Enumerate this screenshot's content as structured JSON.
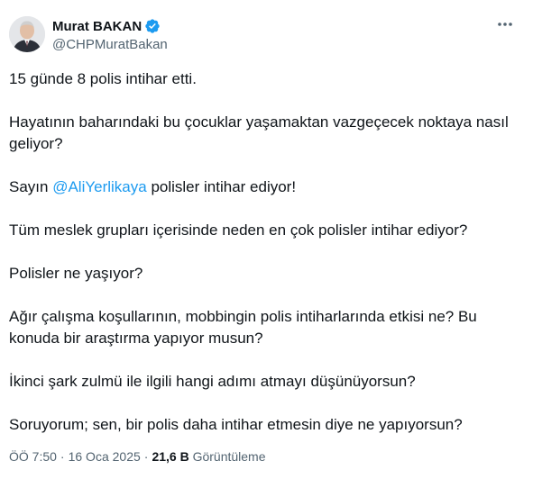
{
  "author": {
    "display_name": "Murat BAKAN",
    "handle": "@CHPMuratBakan"
  },
  "colors": {
    "verified": "#1d9bf0",
    "mention": "#1d9bf0",
    "text": "#0f1419",
    "muted": "#536471"
  },
  "icons": {
    "more": "more-dots-icon",
    "verified": "verified-badge-icon"
  },
  "tweet": {
    "line1": "15 günde 8 polis intihar etti.",
    "line2": "Hayatının baharındaki bu çocuklar yaşamaktan vazgeçecek noktaya nasıl geliyor?",
    "line3_prefix": "Sayın ",
    "line3_mention": "@AliYerlikaya",
    "line3_suffix": " polisler intihar ediyor!",
    "line4": "Tüm meslek grupları içerisinde neden en çok polisler intihar ediyor?",
    "line5": "Polisler ne yaşıyor?",
    "line6": "Ağır çalışma koşullarının, mobbingin polis intiharlarında etkisi ne? Bu konuda bir araştırma yapıyor musun?",
    "line7": "İkinci şark zulmü ile ilgili hangi adımı atmayı düşünüyorsun?",
    "line8": "Soruyorum; sen, bir polis daha intihar etmesin diye ne yapıyorsun?"
  },
  "meta": {
    "time": "ÖÖ 7:50",
    "date": "16 Oca 2025",
    "views_count": "21,6 B",
    "views_label": "Görüntüleme"
  }
}
